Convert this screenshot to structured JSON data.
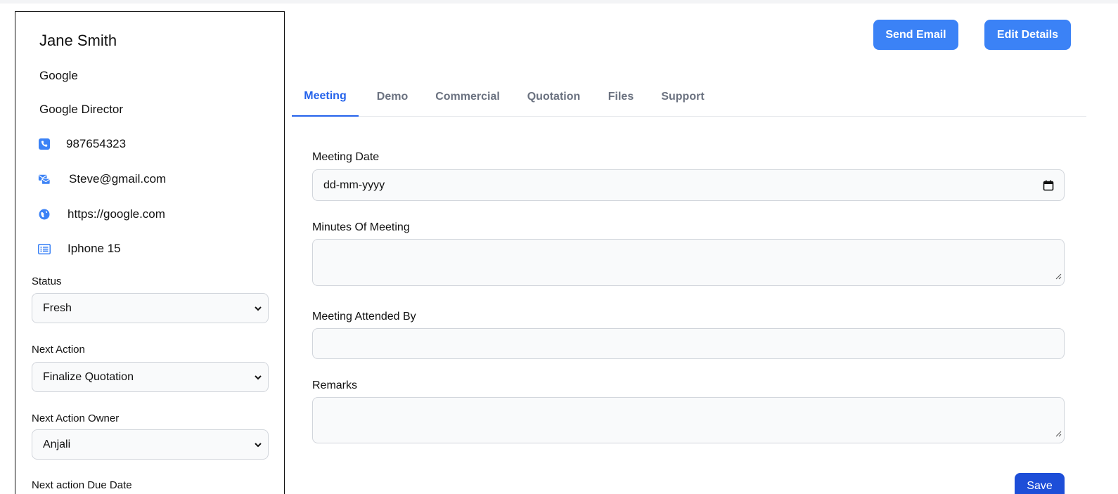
{
  "contact": {
    "name": "Jane Smith",
    "company": "Google",
    "designation": "Google Director",
    "phone": "987654323",
    "email": "Steve@gmail.com",
    "website": "https://google.com",
    "product": "Iphone 15"
  },
  "icons": {
    "phone": "phone-icon",
    "email": "envelope-icon",
    "website": "globe-icon",
    "product": "list-icon",
    "accent": "#3b82f6"
  },
  "sidebar_fields": {
    "status_label": "Status",
    "status_value": "Fresh",
    "next_action_label": "Next Action",
    "next_action_value": "Finalize Quotation",
    "owner_label": "Next Action Owner",
    "owner_value": "Anjali",
    "due_date_label": "Next action Due Date"
  },
  "header": {
    "send_email_label": "Send Email",
    "edit_details_label": "Edit Details"
  },
  "tabs": [
    {
      "label": "Meeting",
      "active": true
    },
    {
      "label": "Demo",
      "active": false
    },
    {
      "label": "Commercial",
      "active": false
    },
    {
      "label": "Quotation",
      "active": false
    },
    {
      "label": "Files",
      "active": false
    },
    {
      "label": "Support",
      "active": false
    }
  ],
  "form": {
    "meeting_date_label": "Meeting Date",
    "meeting_date_placeholder": "dd-mm-yyyy",
    "minutes_label": "Minutes Of Meeting",
    "attended_by_label": "Meeting Attended By",
    "remarks_label": "Remarks",
    "save_label": "Save"
  },
  "colors": {
    "primary": "#3b82f6",
    "active_tab": "#2563eb",
    "save": "#1d4ed8"
  }
}
